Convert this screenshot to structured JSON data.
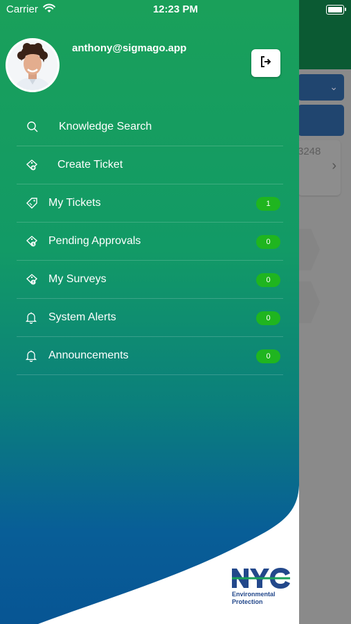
{
  "status_bar": {
    "carrier": "Carrier",
    "time": "12:23 PM"
  },
  "user": {
    "email": "anthony@sigmago.app"
  },
  "menu": [
    {
      "label": "Knowledge Search",
      "icon": "search-icon"
    },
    {
      "label": "Create Ticket",
      "icon": "ticket-add-icon"
    },
    {
      "label": "My Tickets",
      "icon": "tag-icon",
      "badge": "1"
    },
    {
      "label": "Pending Approvals",
      "icon": "ticket-pending-icon",
      "badge": "0"
    },
    {
      "label": "My Surveys",
      "icon": "ticket-survey-icon",
      "badge": "0"
    },
    {
      "label": "System Alerts",
      "icon": "bell-icon",
      "badge": "0"
    },
    {
      "label": "Announcements",
      "icon": "bell-icon",
      "badge": "0"
    }
  ],
  "background": {
    "ticket_number_fragment": "3248"
  },
  "logo": {
    "brand": "NYC",
    "line1": "Environmental",
    "line2": "Protection"
  },
  "colors": {
    "drawer_top": "#1aa05a",
    "drawer_bottom": "#075594",
    "badge": "#1fb51f",
    "logo_blue": "#23488b"
  }
}
